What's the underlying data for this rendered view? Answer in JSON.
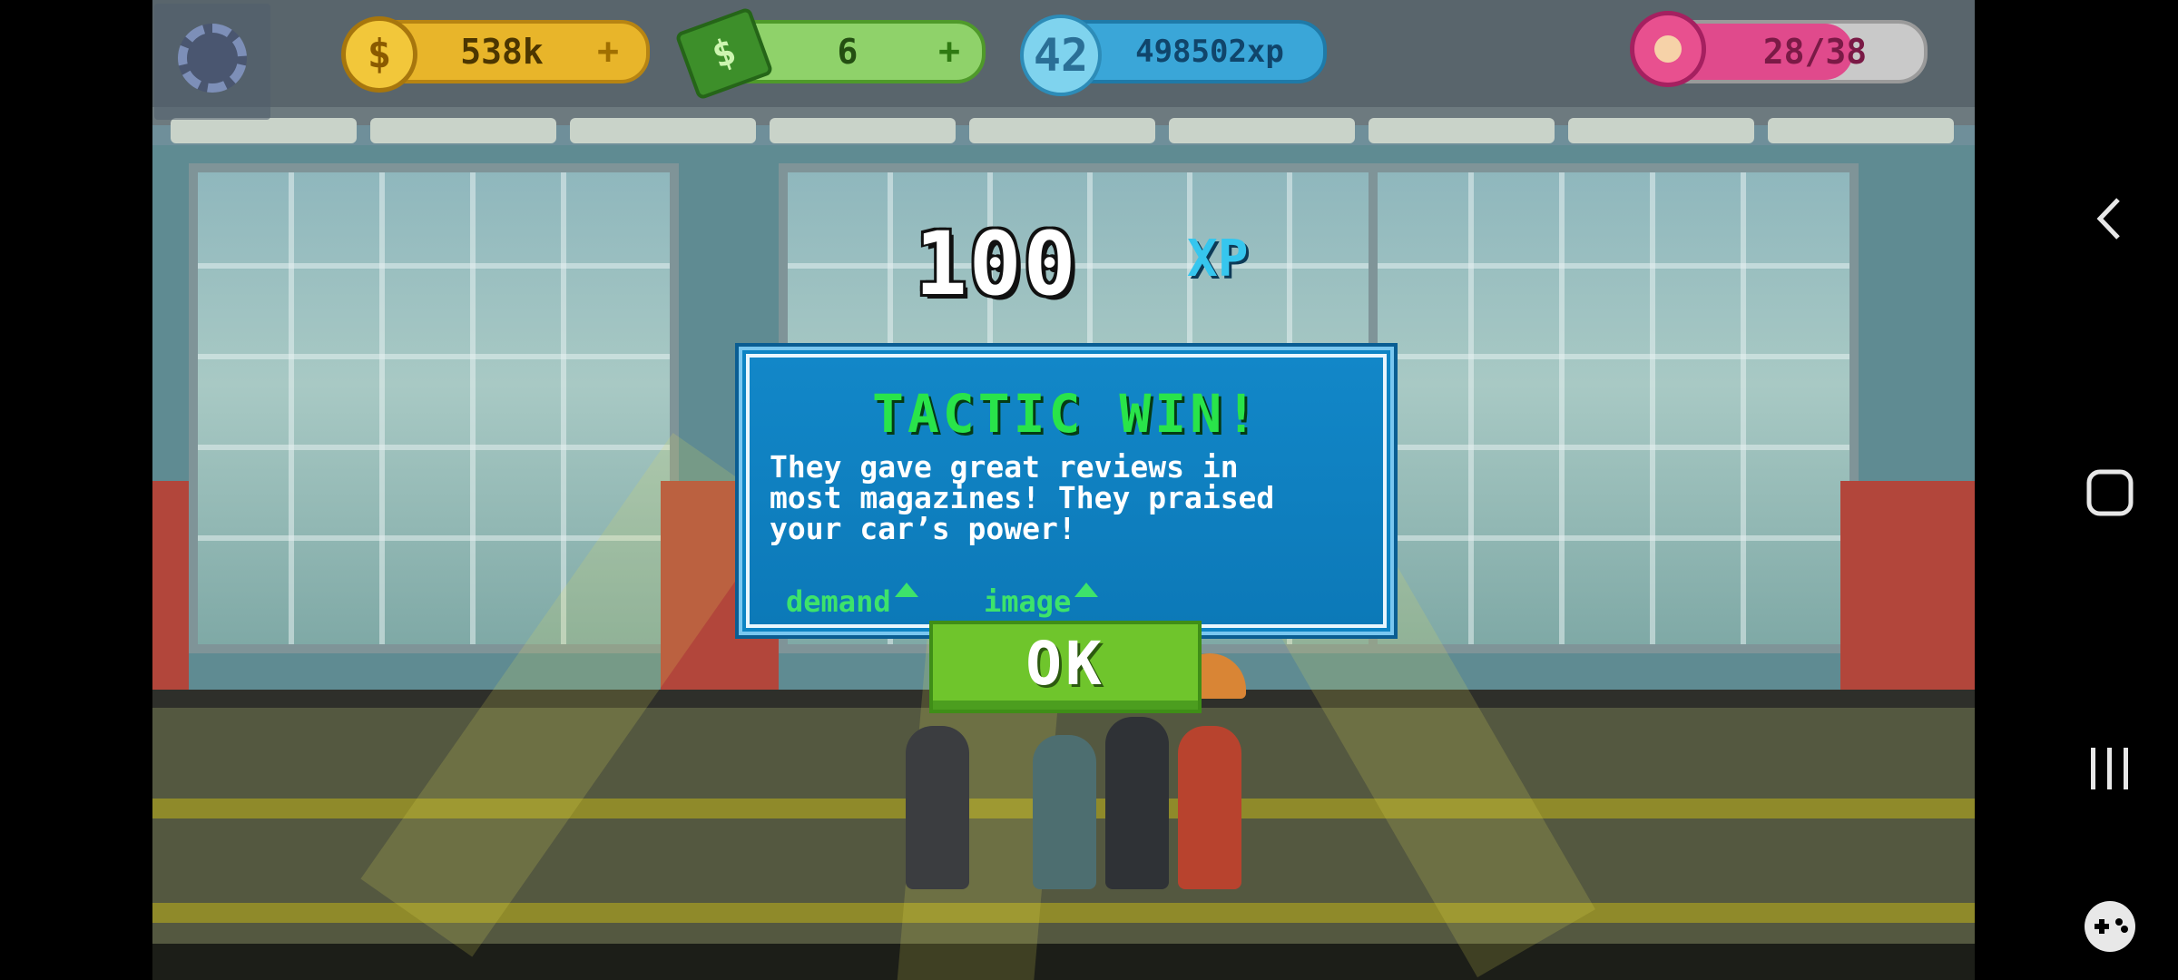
{
  "hud": {
    "coins": "538k",
    "cash": "6",
    "level": "42",
    "xp": "498502xp",
    "fans": "28/38",
    "fans_progress": 0.74,
    "plus": "+"
  },
  "reward": {
    "value": "100",
    "unit": "XP"
  },
  "dialog": {
    "title": "TACTIC WIN!",
    "body": "They gave great reviews in\nmost magazines! They praised\nyour car’s power!",
    "effects": [
      {
        "label": "demand",
        "direction": "up"
      },
      {
        "label": "image",
        "direction": "up"
      }
    ],
    "ok_label": "OK"
  },
  "colors": {
    "title_green": "#29e44a",
    "dialog_blue": "#0d84c4",
    "ok_green": "#6fc52c",
    "xp_cyan": "#36c6ee",
    "coin_gold": "#e8b52a",
    "cash_green": "#5cb83a",
    "fans_pink": "#e04a8c"
  },
  "icons": [
    "settings-gear-icon",
    "coin-icon",
    "cash-icon",
    "level-badge-icon",
    "donut-icon",
    "back-icon",
    "home-icon",
    "recents-icon",
    "gamepad-icon"
  ]
}
